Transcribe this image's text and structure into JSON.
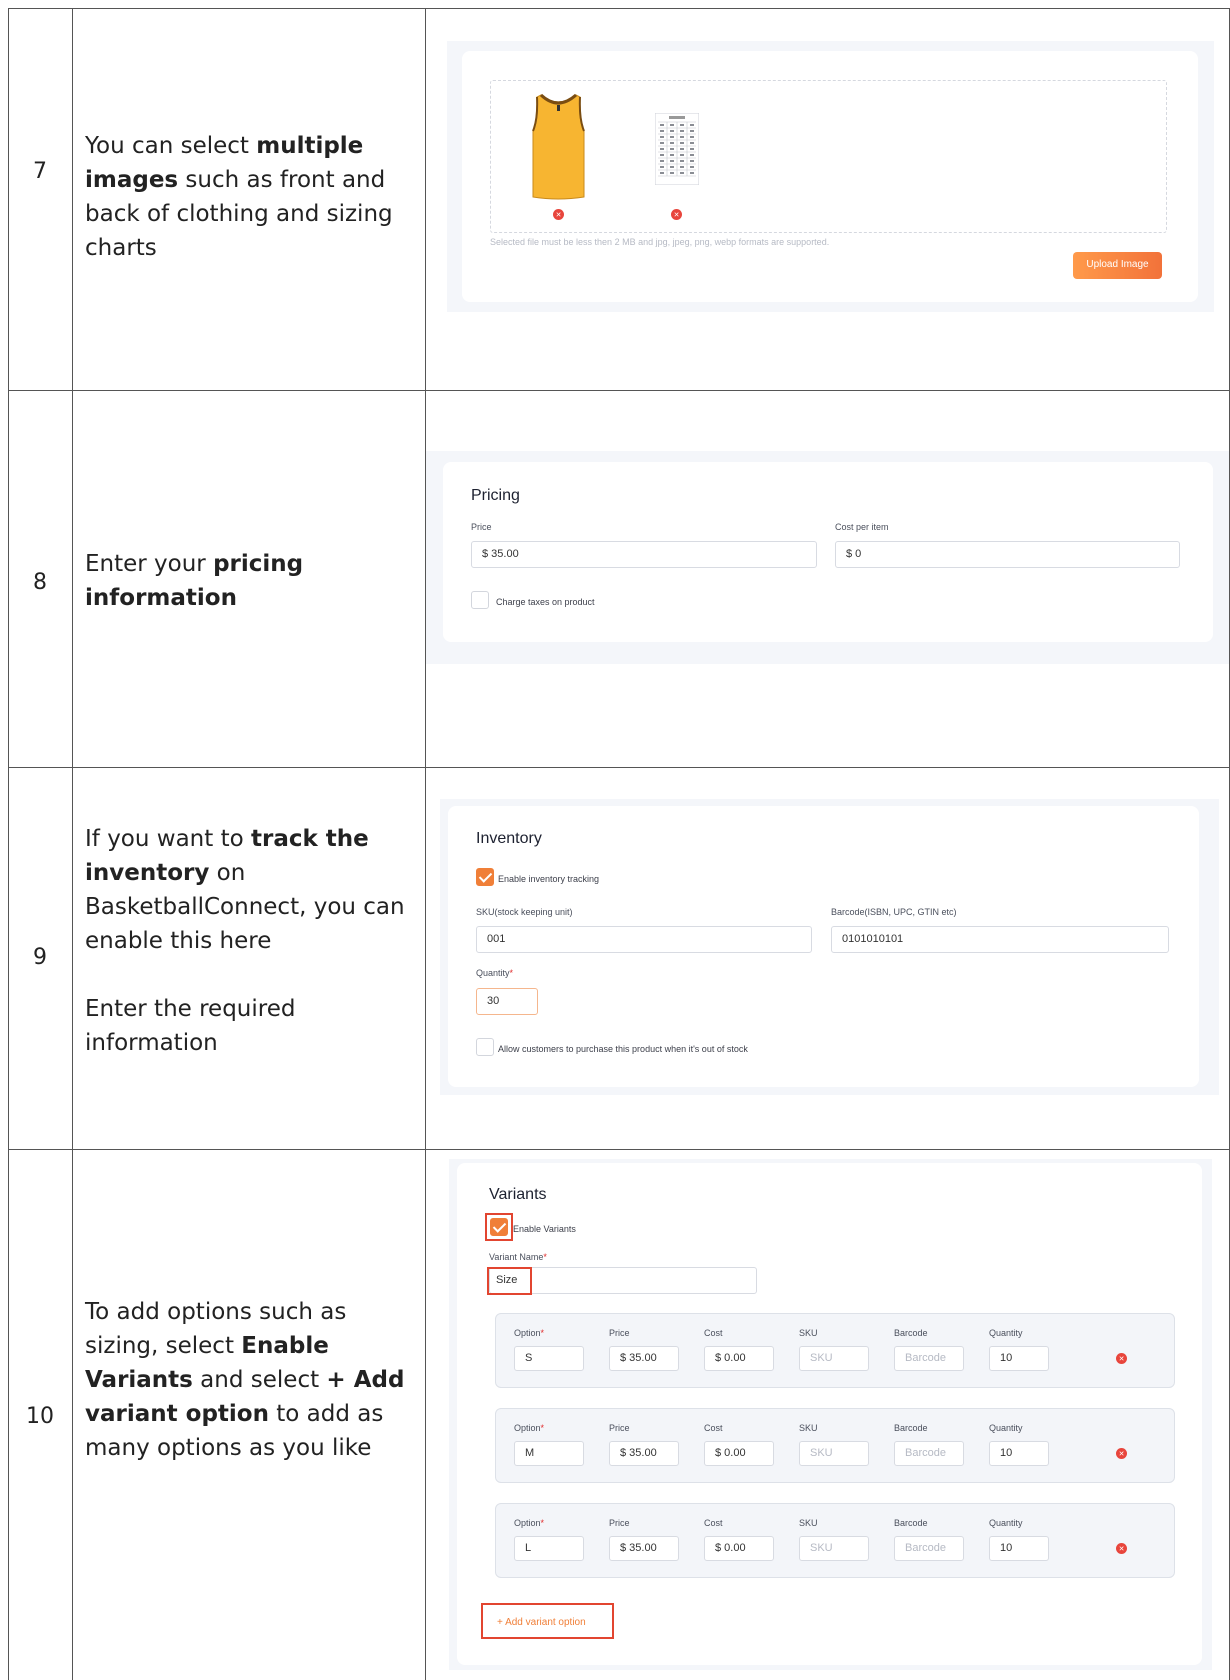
{
  "rows": [
    {
      "number": "7",
      "instruction_parts": [
        "You can select ",
        "multiple images",
        " such as front and back of clothing and sizing charts"
      ]
    },
    {
      "number": "8",
      "instruction_parts": [
        "Enter your ",
        "pricing information"
      ]
    },
    {
      "number": "9",
      "instruction_parts": [
        "If you want to ",
        "track the inventory",
        " on BasketballConnect, you can enable this here"
      ],
      "instruction_extra": "Enter the required information"
    },
    {
      "number": "10",
      "instruction_parts": [
        "To add options such as sizing, select ",
        "Enable Variants",
        " and select ",
        "+ Add variant option",
        " to add as many options as you like"
      ]
    }
  ],
  "upload": {
    "help_text": "Selected file must be less then 2 MB and jpg, jpeg, png, webp formats are supported.",
    "button_label": "Upload Image",
    "accent_color": "#f2723a"
  },
  "pricing": {
    "title": "Pricing",
    "price_label": "Price",
    "price_value": "$ 35.00",
    "cost_label": "Cost per item",
    "cost_value": "$ 0",
    "tax_label": "Charge taxes on product",
    "tax_checked": false
  },
  "inventory": {
    "title": "Inventory",
    "tracking_label": "Enable inventory tracking",
    "tracking_checked": true,
    "sku_label": "SKU(stock keeping unit)",
    "sku_value": "001",
    "barcode_label": "Barcode(ISBN, UPC, GTIN etc)",
    "barcode_value": "0101010101",
    "quantity_label": "Quantity",
    "quantity_required": "*",
    "quantity_value": "30",
    "oos_label": "Allow customers to purchase this product when it's out of stock",
    "oos_checked": false
  },
  "variants": {
    "title": "Variants",
    "enable_label": "Enable Variants",
    "enable_checked": true,
    "name_label": "Variant Name",
    "required_mark": "*",
    "name_value": "Size",
    "headers": {
      "option": "Option",
      "price": "Price",
      "cost": "Cost",
      "sku": "SKU",
      "barcode": "Barcode",
      "quantity": "Quantity"
    },
    "sku_placeholder": "SKU",
    "barcode_placeholder": "Barcode",
    "options": [
      {
        "option": "S",
        "price": "$ 35.00",
        "cost": "$ 0.00",
        "quantity": "10"
      },
      {
        "option": "M",
        "price": "$ 35.00",
        "cost": "$ 0.00",
        "quantity": "10"
      },
      {
        "option": "L",
        "price": "$ 35.00",
        "cost": "$ 0.00",
        "quantity": "10"
      }
    ],
    "add_label": "+ Add variant option"
  }
}
